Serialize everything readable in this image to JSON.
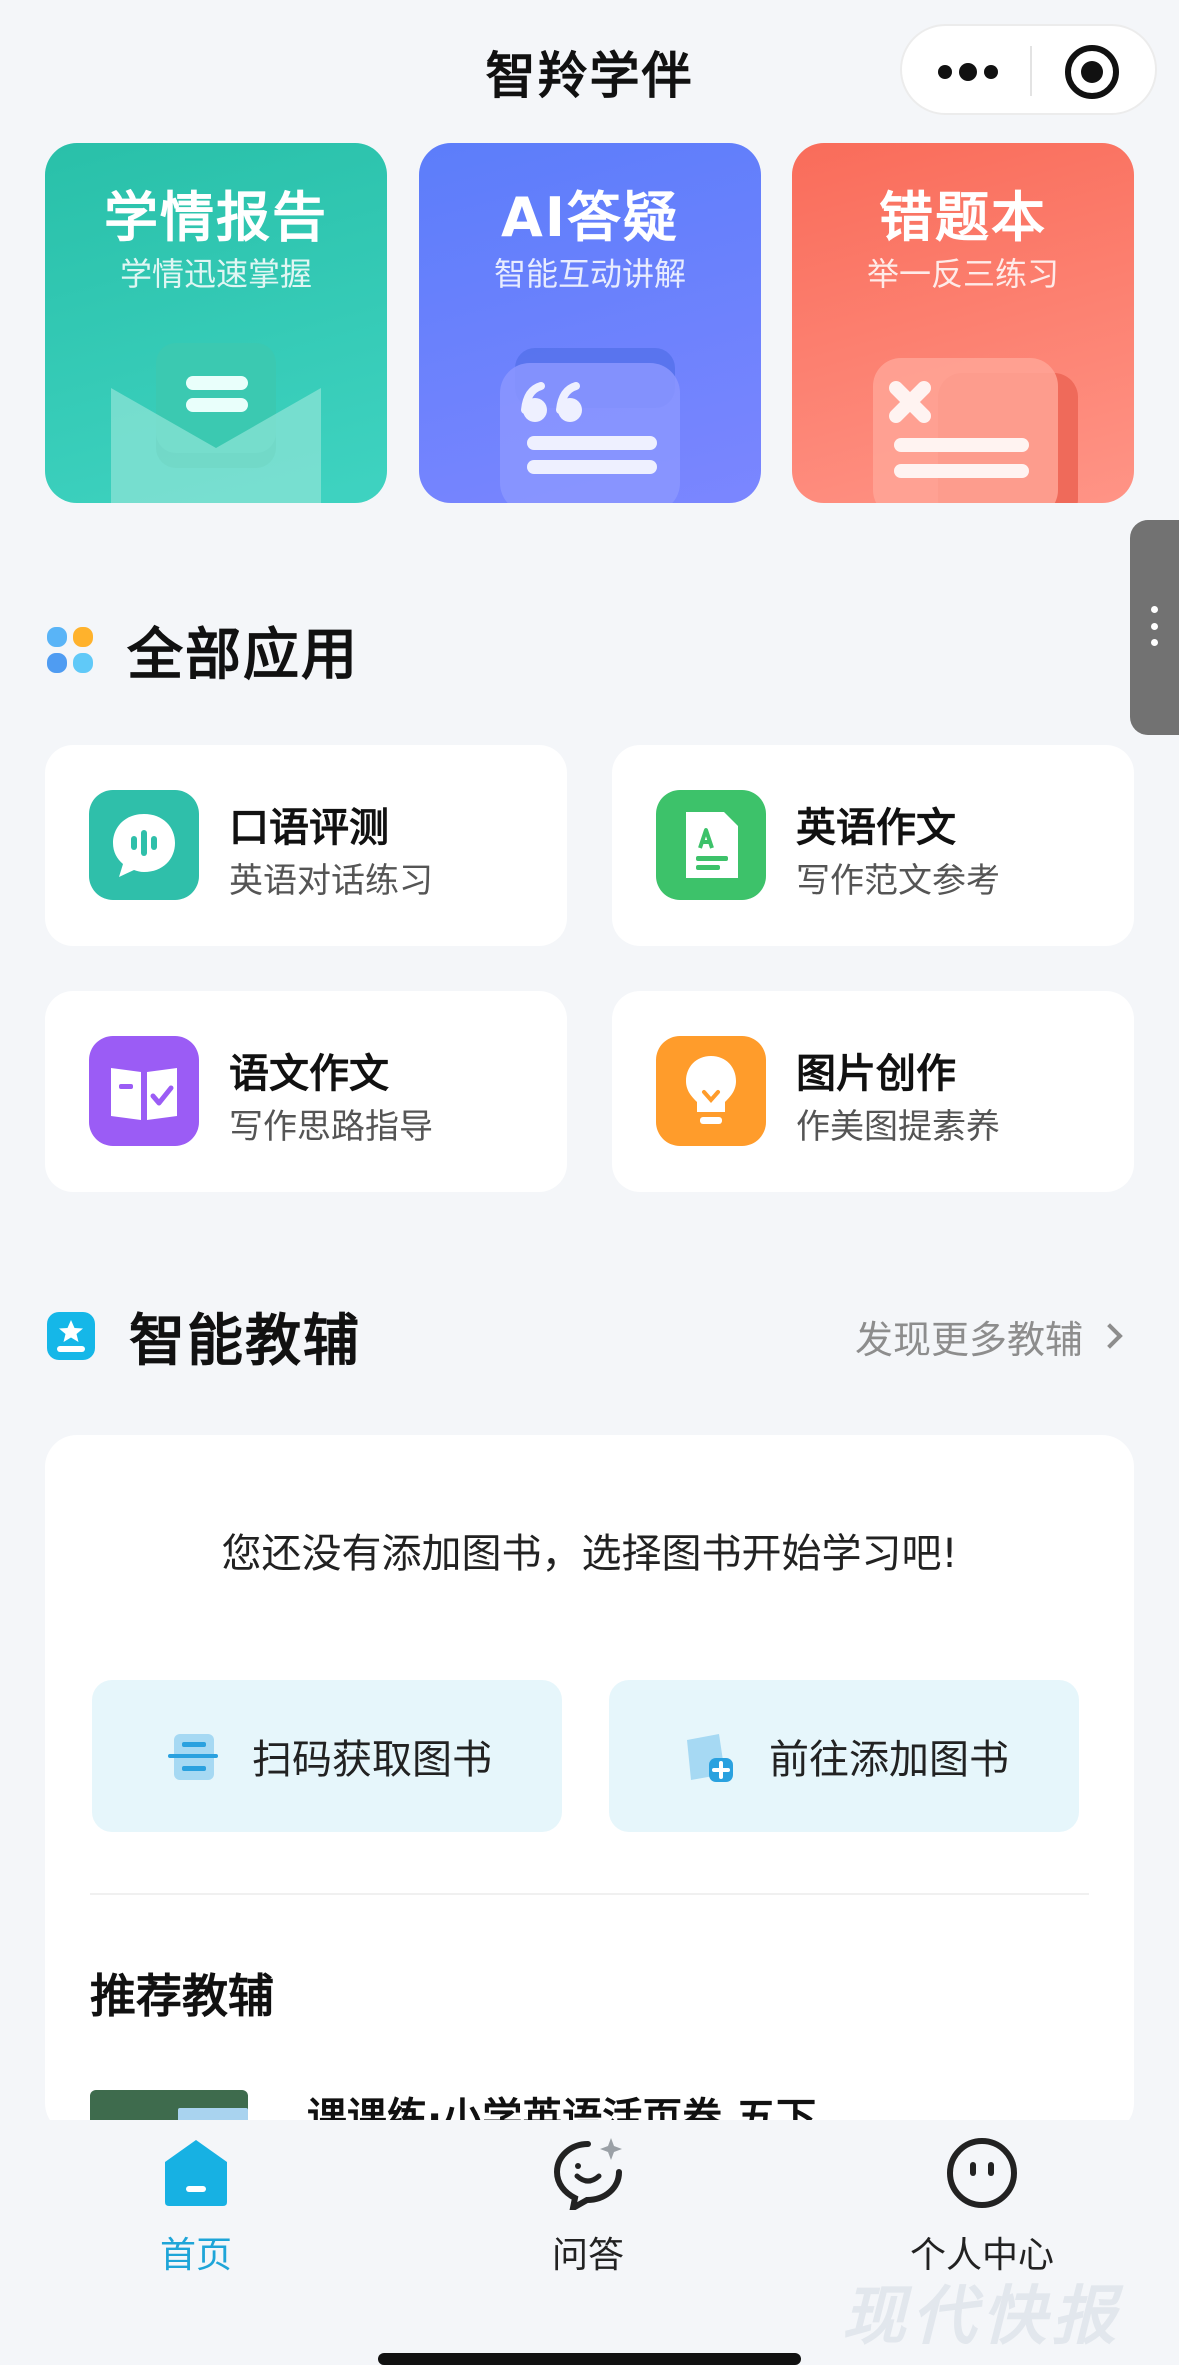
{
  "header": {
    "title": "智羚学伴"
  },
  "features": [
    {
      "title": "学情报告",
      "subtitle": "学情迅速掌握"
    },
    {
      "title": "AI答疑",
      "subtitle": "智能互动讲解"
    },
    {
      "title": "错题本",
      "subtitle": "举一反三练习"
    }
  ],
  "apps_section": {
    "title": "全部应用"
  },
  "apps": [
    {
      "name": "口语评测",
      "desc": "英语对话练习",
      "color": "#2fbfaa"
    },
    {
      "name": "英语作文",
      "desc": "写作范文参考",
      "color": "#3dc26a"
    },
    {
      "name": "语文作文",
      "desc": "写作思路指导",
      "color": "#9b5cf5"
    },
    {
      "name": "图片创作",
      "desc": "作美图提素养",
      "color": "#ff9c2b"
    }
  ],
  "tutor_section": {
    "title": "智能教辅",
    "more_label": "发现更多教辅"
  },
  "tutor_card": {
    "empty_text": "您还没有添加图书，选择图书开始学习吧!",
    "scan_label": "扫码获取图书",
    "add_label": "前往添加图书",
    "recommend_title": "推荐教辅",
    "book_name": "课课练·小学英语活页卷 五下"
  },
  "tabbar": {
    "home": "首页",
    "qa": "问答",
    "me": "个人中心"
  },
  "watermark": "现代快报",
  "colors": {
    "accent": "#1ea5d8",
    "background": "#f4f6f9"
  }
}
